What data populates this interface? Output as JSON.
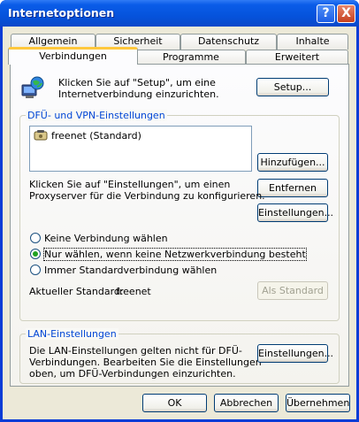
{
  "window": {
    "title": "Internetoptionen",
    "help_button": "?",
    "close_button": "X"
  },
  "tabs": {
    "row1": [
      "Allgemein",
      "Sicherheit",
      "Datenschutz",
      "Inhalte"
    ],
    "row2": [
      "Verbindungen",
      "Programme",
      "Erweitert"
    ],
    "active": "Verbindungen"
  },
  "setup": {
    "text_line1": "Klicken Sie auf \"Setup\", um eine",
    "text_line2": "Internetverbindung einzurichten.",
    "button": "Setup..."
  },
  "dialup": {
    "legend": "DFÜ- und VPN-Einstellungen",
    "connections": [
      {
        "name": "freenet (Standard)",
        "icon": "dialup-connection-icon"
      }
    ],
    "add_button": "Hinzufügen...",
    "remove_button": "Entfernen",
    "settings_text_line1": "Klicken Sie auf \"Einstellungen\", um einen",
    "settings_text_line2": "Proxyserver für die Verbindung zu konfigurieren.",
    "settings_button": "Einstellungen...",
    "options": [
      {
        "label": "Keine Verbindung wählen",
        "selected": false
      },
      {
        "label": "Nur wählen, wenn keine Netzwerkverbindung besteht",
        "selected": true
      },
      {
        "label": "Immer Standardverbindung wählen",
        "selected": false
      }
    ],
    "current_default_label": "Aktueller Standard:",
    "current_default_value": "freenet",
    "set_default_button": "Als Standard"
  },
  "lan": {
    "legend": "LAN-Einstellungen",
    "text_line1": "Die LAN-Einstellungen gelten nicht für DFÜ-",
    "text_line2": "Verbindungen. Bearbeiten Sie die Einstellungen",
    "text_line3": "oben, um DFÜ-Verbindungen einzurichten.",
    "settings_button": "Einstellungen..."
  },
  "footer": {
    "ok": "OK",
    "cancel": "Abbrechen",
    "apply": "Übernehmen"
  },
  "colors": {
    "titlebar": "#0553dc",
    "legend_text": "#0046d5",
    "radio_dot": "#21a121",
    "tab_active_accent": "#ffc83c"
  }
}
